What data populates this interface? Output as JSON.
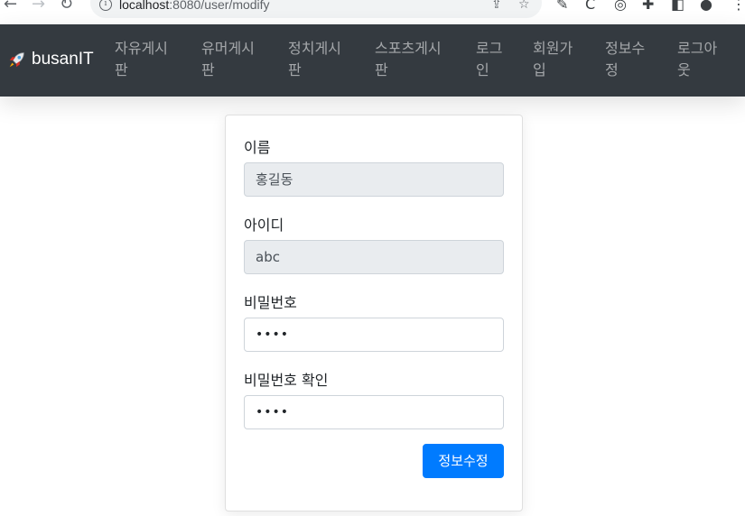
{
  "browser": {
    "url_host": "localhost",
    "url_path": ":8080/user/modify"
  },
  "navbar": {
    "brand": "busanIT",
    "items": [
      {
        "line1": "자유게시",
        "line2": "판"
      },
      {
        "line1": "유머게시",
        "line2": "판"
      },
      {
        "line1": "정치게시",
        "line2": "판"
      },
      {
        "line1": "스포츠게시",
        "line2": "판"
      },
      {
        "line1": "로그",
        "line2": "인"
      },
      {
        "line1": "회원가",
        "line2": "입"
      },
      {
        "line1": "정보수",
        "line2": "정"
      },
      {
        "line1": "로그아",
        "line2": "웃"
      }
    ]
  },
  "form": {
    "name_label": "이름",
    "name_value": "홍길동",
    "id_label": "아이디",
    "id_value": "abc",
    "password_label": "비밀번호",
    "password_value": "••••",
    "password_confirm_label": "비밀번호 확인",
    "password_confirm_value": "••••",
    "submit_label": "정보수정"
  },
  "colors": {
    "navbar_bg": "#343a40",
    "primary": "#007bff",
    "readonly_bg": "#e9ecef"
  }
}
